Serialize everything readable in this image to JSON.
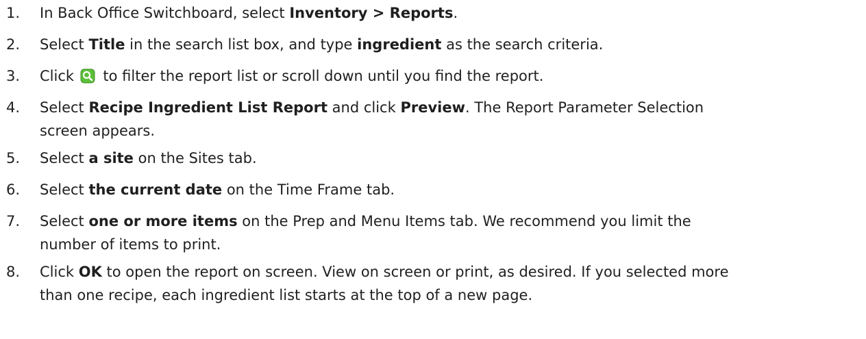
{
  "steps": [
    {
      "number": "1.",
      "parts": [
        {
          "t": "In Back Office Switchboard, select "
        },
        {
          "t": "Inventory > Reports",
          "b": true
        },
        {
          "t": "."
        }
      ]
    },
    {
      "number": "2.",
      "parts": [
        {
          "t": "Select "
        },
        {
          "t": "Title",
          "b": true
        },
        {
          "t": " in the search list box, and type "
        },
        {
          "t": "ingredient",
          "b": true
        },
        {
          "t": " as the search criteria."
        }
      ]
    },
    {
      "number": "3.",
      "parts": [
        {
          "t": "Click "
        },
        {
          "icon": "search-icon"
        },
        {
          "t": " to filter the report list or scroll down until you find the report."
        }
      ]
    },
    {
      "number": "4.",
      "parts": [
        {
          "t": "Select "
        },
        {
          "t": "Recipe Ingredient List Report",
          "b": true
        },
        {
          "t": " and click "
        },
        {
          "t": "Preview",
          "b": true
        },
        {
          "t": ". The Report Parameter Selection"
        },
        {
          "br": true
        },
        {
          "t": "screen appears."
        }
      ]
    },
    {
      "number": "5.",
      "parts": [
        {
          "t": "Select "
        },
        {
          "t": "a site",
          "b": true
        },
        {
          "t": " on the Sites tab."
        }
      ]
    },
    {
      "number": "6.",
      "parts": [
        {
          "t": "Select "
        },
        {
          "t": "the current date",
          "b": true
        },
        {
          "t": " on the Time Frame tab."
        }
      ]
    },
    {
      "number": "7.",
      "parts": [
        {
          "t": "Select "
        },
        {
          "t": "one or more items",
          "b": true
        },
        {
          "t": " on the Prep and Menu Items tab. We recommend you limit the"
        },
        {
          "br": true
        },
        {
          "t": "number of items to print."
        }
      ]
    },
    {
      "number": "8.",
      "parts": [
        {
          "t": "Click "
        },
        {
          "t": "OK",
          "b": true
        },
        {
          "t": " to open the report on screen. View on screen or print, as desired. If you selected more"
        },
        {
          "br": true
        },
        {
          "t": "than one recipe, each ingredient list starts at the top of a new page."
        }
      ]
    }
  ],
  "icon_colors": {
    "search_bg": "#5cbf3a",
    "search_border": "#3d8f25",
    "glass": "#ffffff"
  }
}
